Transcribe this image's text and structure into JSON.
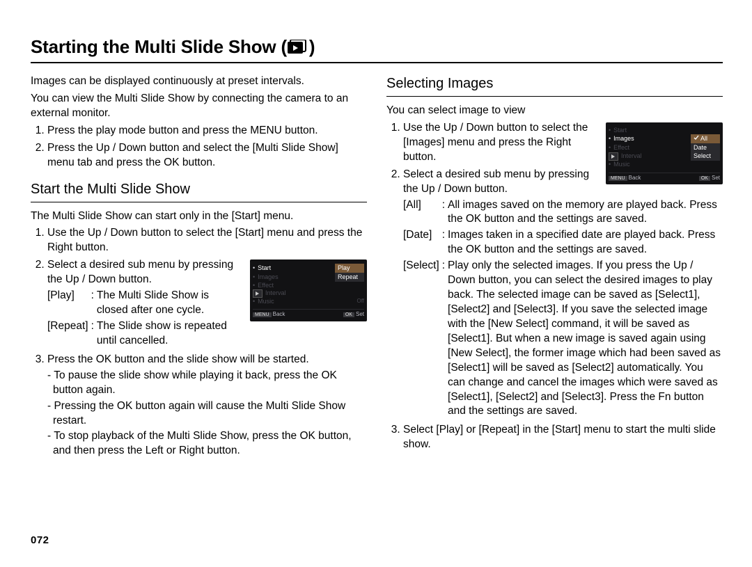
{
  "title": {
    "prefix": "Starting the Multi Slide Show ( ",
    "suffix": " )"
  },
  "left": {
    "intro": {
      "l1": "Images can be displayed continuously at preset intervals.",
      "l2": "You can view the Multi Slide Show by connecting the camera to an external monitor."
    },
    "steps_top": {
      "s1": "Press the play mode button and press the MENU button.",
      "s2": "Press the Up / Down button and select the [Multi Slide Show] menu tab and press the OK button."
    },
    "subhead": "Start the Multi Slide Show",
    "lead": "The Multi Slide Show can start only in the [Start] menu.",
    "steps": {
      "s1": "Use the Up / Down button to select the [Start] menu and press the Right button.",
      "s2": "Select a desired sub menu by pressing the Up / Down button.",
      "opts": {
        "play_key": "[Play]",
        "play_val": "The Multi Slide Show is closed after one cycle.",
        "repeat_key": "[Repeat]",
        "repeat_val": "The Slide show is repeated until cancelled."
      },
      "s3": "Press the OK button and the slide show will be started.",
      "s3b": {
        "a": "To pause the slide show while playing it back, press the OK button again.",
        "b": "Pressing the OK button again will cause the Multi Slide Show restart.",
        "c": "To stop playback of the Multi Slide Show, press the OK button, and then press the Left or Right button."
      }
    },
    "shot": {
      "items": [
        "Start",
        "Images",
        "Effect",
        "Interval",
        "Music"
      ],
      "sel1": "Play",
      "sel2": "Repeat",
      "off": "Off",
      "back": "Back",
      "set": "Set",
      "menu": "MENU",
      "ok": "OK"
    }
  },
  "right": {
    "subhead": "Selecting Images",
    "lead": "You can select image to view",
    "steps": {
      "s1": "Use the Up / Down button to select the [Images] menu and press the Right button.",
      "s2": "Select a desired sub menu by pressing the Up / Down button.",
      "opts": {
        "all_key": "[All]",
        "all_val": "All images saved on the memory are played back. Press the OK button and the settings are saved.",
        "date_key": "[Date]",
        "date_val": "Images taken in a specified date are played back. Press the OK button and the settings are saved.",
        "select_key": "[Select]",
        "select_val": "Play only the selected images. If you press the Up / Down button, you can select the desired images to play back. The selected image can be saved as [Select1], [Select2] and [Select3]. If you save the selected image with the [New Select] command, it will be saved as [Select1]. But when a new image is saved again using [New Select], the former image which had been saved as [Select1] will be saved as [Select2] automatically. You can change and cancel the images which were saved as [Select1], [Select2] and [Select3]. Press the Fn button and the settings are saved."
      },
      "s3": "Select [Play] or [Repeat] in the [Start] menu to start the multi slide show."
    },
    "shot": {
      "items": [
        "Start",
        "Images",
        "Effect",
        "Interval",
        "Music"
      ],
      "sel1": "All",
      "sel2": "Date",
      "sel3": "Select",
      "back": "Back",
      "set": "Set",
      "menu": "MENU",
      "ok": "OK"
    }
  },
  "pagenum": "072"
}
